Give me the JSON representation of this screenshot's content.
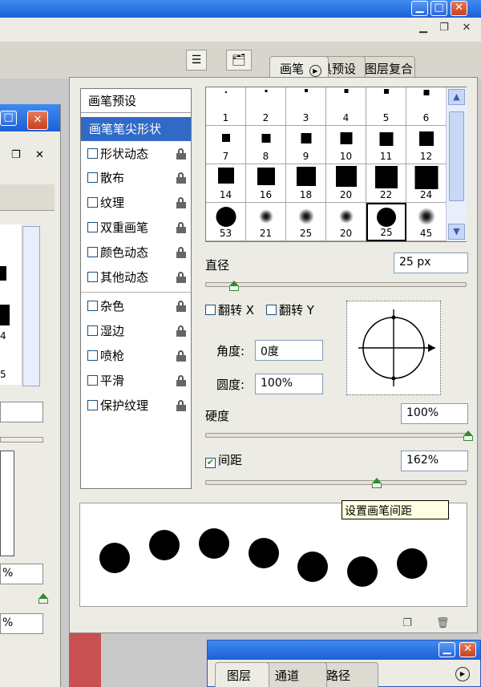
{
  "top_tabs": [
    "画笔",
    "具预设",
    "图层复合"
  ],
  "options": {
    "header": "画笔预设",
    "selected": "画笔笔尖形状",
    "group1": [
      "形状动态",
      "散布",
      "纹理",
      "双重画笔",
      "颜色动态",
      "其他动态"
    ],
    "group2": [
      "杂色",
      "湿边",
      "喷枪",
      "平滑",
      "保护纹理"
    ]
  },
  "brush_tips": [
    "1",
    "2",
    "3",
    "4",
    "5",
    "6",
    "7",
    "8",
    "9",
    "10",
    "11",
    "12",
    "14",
    "16",
    "18",
    "20",
    "22",
    "24",
    "53",
    "21",
    "25",
    "20",
    "25",
    "45"
  ],
  "controls": {
    "diameter_label": "直径",
    "diameter_value": "25 px",
    "diameter_level": 0.1,
    "flip_x_label": "翻转 X",
    "flip_y_label": "翻转 Y",
    "angle_label": "角度:",
    "angle_value": "0度",
    "roundness_label": "圆度:",
    "roundness_value": "100%",
    "hardness_label": "硬度",
    "hardness_value": "100%",
    "hardness_level": 1.0,
    "spacing_label": "间距",
    "spacing_checked": true,
    "spacing_value": "162%",
    "spacing_level": 0.66
  },
  "tooltip": "设置画笔间距",
  "left_window_values": [
    "%",
    "%"
  ],
  "left_window_numbers": [
    "4",
    "5"
  ],
  "bottom_tabs": [
    "图层",
    "通道",
    "路径"
  ],
  "colors": {
    "selection": "#3169c6",
    "titlebar": "#2a66dd",
    "handle": "#2e8c2e"
  }
}
